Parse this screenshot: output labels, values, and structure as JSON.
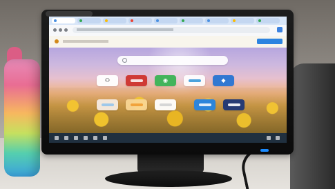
{
  "image": {
    "subject": "",
    "screen_content": ""
  },
  "colors": {
    "monitor_frame": "#111111",
    "screen_bg": "#f3f4f6",
    "accent_blue": "#2d84e0",
    "status_led": "#1a8bff",
    "bottle_pink": "#e96d93"
  },
  "browser": {
    "tabs_count": 9,
    "notice_action_color": "#2d84e0",
    "search_placeholder": "",
    "tiles": [
      {
        "name": "assistant-tile",
        "color": "#ffffff"
      },
      {
        "name": "red-app-tile",
        "color": "#cf3a35"
      },
      {
        "name": "whatsapp-tile",
        "color": "#43b45b"
      },
      {
        "name": "payment-tile",
        "color": "#ffffff"
      },
      {
        "name": "blue-app-tile",
        "color": "#3178d2"
      },
      {
        "name": "cloud-tile",
        "color": "#f5ebe1"
      },
      {
        "name": "orange-tile",
        "color": "#f9d694"
      },
      {
        "name": "white-tile",
        "color": "#ffffff"
      },
      {
        "name": "booking-tile",
        "color": "#2c85db"
      },
      {
        "name": "dark-brand-tile",
        "color": "#263b74"
      }
    ]
  }
}
